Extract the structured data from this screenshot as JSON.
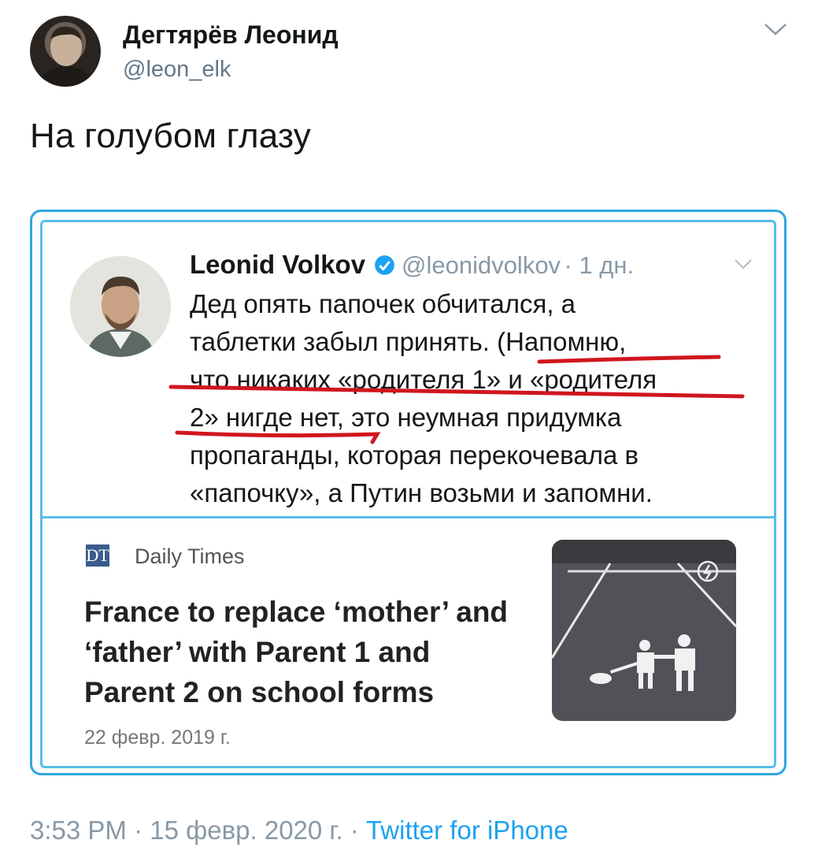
{
  "tweet": {
    "author_name": "Дегтярёв Леонид",
    "author_handle": "@leon_elk",
    "text": "На голубом глазу",
    "time": "3:53 PM",
    "separator": "·",
    "date": "15 февр. 2020 г.",
    "source": "Twitter for iPhone"
  },
  "quoted": {
    "name": "Leonid Volkov",
    "handle": "@leonidvolkov",
    "meta": "· 1 дн.",
    "lines": [
      "Дед опять папочек обчитался, а",
      "таблетки забыл принять. (Напомню,",
      "что никаких «родителя 1» и «родителя",
      "2» нигде нет, это неумная придумка",
      "пропаганды, которая перекочевала в",
      "«папочку», а Путин возьми и запомни."
    ],
    "card": {
      "logo": "DT",
      "source": "Daily Times",
      "title": "France to replace ‘mother’ and ‘father’ with Parent 1 and Parent 2 on school forms",
      "date": "22 февр. 2019 г."
    }
  },
  "icons": {
    "menu": "chevron-down-icon",
    "verified": "verified-badge-icon",
    "lightning": "lightning-icon"
  },
  "colors": {
    "accent": "#1da1f2",
    "frame": "#2fa6e0",
    "underline": "#d0161e",
    "muted": "#8899a6"
  }
}
